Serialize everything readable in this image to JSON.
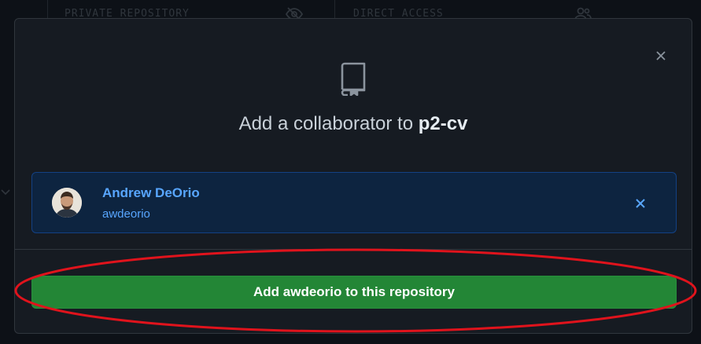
{
  "background": {
    "private_label": "PRIVATE REPOSITORY",
    "direct_label": "DIRECT ACCESS",
    "icons": [
      "eye-closed-icon",
      "people-icon",
      "chevron-down-icon"
    ]
  },
  "modal": {
    "close_icon": "x-icon",
    "repo_icon": "repo-icon",
    "title_prefix": "Add a collaborator to ",
    "repo_name": "p2-cv",
    "selected_user": {
      "display_name": "Andrew DeOrio",
      "login": "awdeorio",
      "avatar_icon": "user-avatar",
      "remove_icon": "x-icon"
    },
    "submit_label": "Add awdeorio to this repository"
  },
  "annotation": {
    "color": "#e0131c",
    "shape": "ellipse"
  },
  "colors": {
    "background": "#0d1117",
    "modal": "#161b22",
    "border": "#30363d",
    "accent_blue": "#58a6ff",
    "button_green": "#238636"
  }
}
